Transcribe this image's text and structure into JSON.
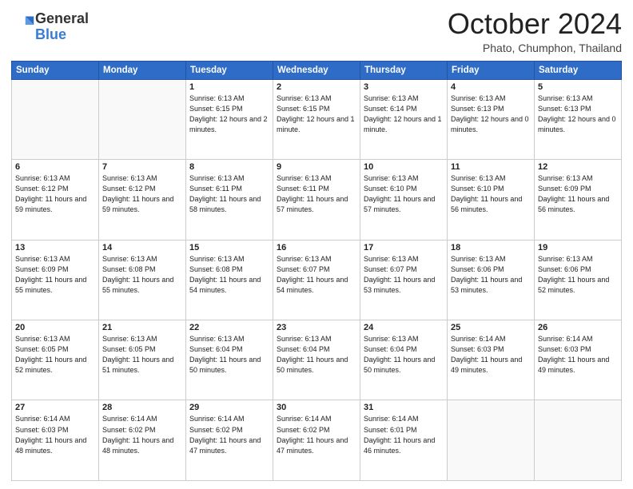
{
  "header": {
    "logo_general": "General",
    "logo_blue": "Blue",
    "month": "October 2024",
    "location": "Phato, Chumphon, Thailand"
  },
  "weekdays": [
    "Sunday",
    "Monday",
    "Tuesday",
    "Wednesday",
    "Thursday",
    "Friday",
    "Saturday"
  ],
  "weeks": [
    [
      {
        "day": "",
        "info": ""
      },
      {
        "day": "",
        "info": ""
      },
      {
        "day": "1",
        "info": "Sunrise: 6:13 AM\nSunset: 6:15 PM\nDaylight: 12 hours and 2 minutes."
      },
      {
        "day": "2",
        "info": "Sunrise: 6:13 AM\nSunset: 6:15 PM\nDaylight: 12 hours and 1 minute."
      },
      {
        "day": "3",
        "info": "Sunrise: 6:13 AM\nSunset: 6:14 PM\nDaylight: 12 hours and 1 minute."
      },
      {
        "day": "4",
        "info": "Sunrise: 6:13 AM\nSunset: 6:13 PM\nDaylight: 12 hours and 0 minutes."
      },
      {
        "day": "5",
        "info": "Sunrise: 6:13 AM\nSunset: 6:13 PM\nDaylight: 12 hours and 0 minutes."
      }
    ],
    [
      {
        "day": "6",
        "info": "Sunrise: 6:13 AM\nSunset: 6:12 PM\nDaylight: 11 hours and 59 minutes."
      },
      {
        "day": "7",
        "info": "Sunrise: 6:13 AM\nSunset: 6:12 PM\nDaylight: 11 hours and 59 minutes."
      },
      {
        "day": "8",
        "info": "Sunrise: 6:13 AM\nSunset: 6:11 PM\nDaylight: 11 hours and 58 minutes."
      },
      {
        "day": "9",
        "info": "Sunrise: 6:13 AM\nSunset: 6:11 PM\nDaylight: 11 hours and 57 minutes."
      },
      {
        "day": "10",
        "info": "Sunrise: 6:13 AM\nSunset: 6:10 PM\nDaylight: 11 hours and 57 minutes."
      },
      {
        "day": "11",
        "info": "Sunrise: 6:13 AM\nSunset: 6:10 PM\nDaylight: 11 hours and 56 minutes."
      },
      {
        "day": "12",
        "info": "Sunrise: 6:13 AM\nSunset: 6:09 PM\nDaylight: 11 hours and 56 minutes."
      }
    ],
    [
      {
        "day": "13",
        "info": "Sunrise: 6:13 AM\nSunset: 6:09 PM\nDaylight: 11 hours and 55 minutes."
      },
      {
        "day": "14",
        "info": "Sunrise: 6:13 AM\nSunset: 6:08 PM\nDaylight: 11 hours and 55 minutes."
      },
      {
        "day": "15",
        "info": "Sunrise: 6:13 AM\nSunset: 6:08 PM\nDaylight: 11 hours and 54 minutes."
      },
      {
        "day": "16",
        "info": "Sunrise: 6:13 AM\nSunset: 6:07 PM\nDaylight: 11 hours and 54 minutes."
      },
      {
        "day": "17",
        "info": "Sunrise: 6:13 AM\nSunset: 6:07 PM\nDaylight: 11 hours and 53 minutes."
      },
      {
        "day": "18",
        "info": "Sunrise: 6:13 AM\nSunset: 6:06 PM\nDaylight: 11 hours and 53 minutes."
      },
      {
        "day": "19",
        "info": "Sunrise: 6:13 AM\nSunset: 6:06 PM\nDaylight: 11 hours and 52 minutes."
      }
    ],
    [
      {
        "day": "20",
        "info": "Sunrise: 6:13 AM\nSunset: 6:05 PM\nDaylight: 11 hours and 52 minutes."
      },
      {
        "day": "21",
        "info": "Sunrise: 6:13 AM\nSunset: 6:05 PM\nDaylight: 11 hours and 51 minutes."
      },
      {
        "day": "22",
        "info": "Sunrise: 6:13 AM\nSunset: 6:04 PM\nDaylight: 11 hours and 50 minutes."
      },
      {
        "day": "23",
        "info": "Sunrise: 6:13 AM\nSunset: 6:04 PM\nDaylight: 11 hours and 50 minutes."
      },
      {
        "day": "24",
        "info": "Sunrise: 6:13 AM\nSunset: 6:04 PM\nDaylight: 11 hours and 50 minutes."
      },
      {
        "day": "25",
        "info": "Sunrise: 6:14 AM\nSunset: 6:03 PM\nDaylight: 11 hours and 49 minutes."
      },
      {
        "day": "26",
        "info": "Sunrise: 6:14 AM\nSunset: 6:03 PM\nDaylight: 11 hours and 49 minutes."
      }
    ],
    [
      {
        "day": "27",
        "info": "Sunrise: 6:14 AM\nSunset: 6:03 PM\nDaylight: 11 hours and 48 minutes."
      },
      {
        "day": "28",
        "info": "Sunrise: 6:14 AM\nSunset: 6:02 PM\nDaylight: 11 hours and 48 minutes."
      },
      {
        "day": "29",
        "info": "Sunrise: 6:14 AM\nSunset: 6:02 PM\nDaylight: 11 hours and 47 minutes."
      },
      {
        "day": "30",
        "info": "Sunrise: 6:14 AM\nSunset: 6:02 PM\nDaylight: 11 hours and 47 minutes."
      },
      {
        "day": "31",
        "info": "Sunrise: 6:14 AM\nSunset: 6:01 PM\nDaylight: 11 hours and 46 minutes."
      },
      {
        "day": "",
        "info": ""
      },
      {
        "day": "",
        "info": ""
      }
    ]
  ]
}
